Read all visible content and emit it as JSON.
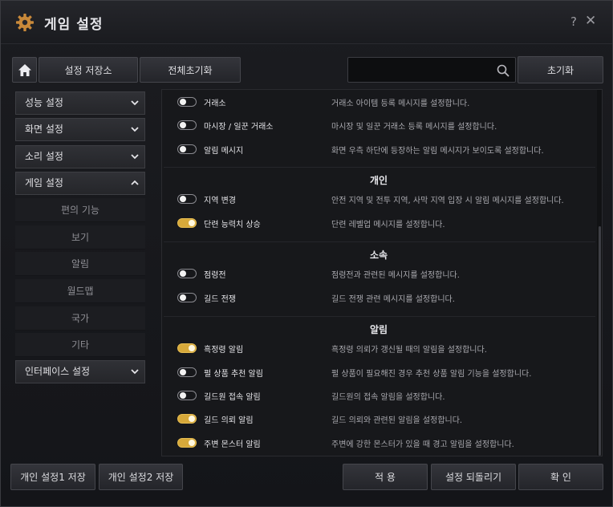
{
  "window": {
    "title": "게임 설정",
    "help": "?",
    "close": "✕"
  },
  "toolbar": {
    "save_store": "설정 저장소",
    "reset_all": "전체초기화",
    "search_value": "",
    "reset": "초기화"
  },
  "sidebar": {
    "categories": [
      {
        "label": "성능 설정",
        "state": "collapsed"
      },
      {
        "label": "화면 설정",
        "state": "collapsed"
      },
      {
        "label": "소리 설정",
        "state": "collapsed"
      },
      {
        "label": "게임 설정",
        "state": "expanded"
      },
      {
        "label": "인터페이스 설정",
        "state": "collapsed"
      }
    ],
    "subitems": [
      "편의 기능",
      "보기",
      "알림",
      "월드맵",
      "국가",
      "기타"
    ]
  },
  "content": {
    "top_rows": [
      {
        "label": "거래소",
        "desc": "거래소 아이템 등록 메시지를 설정합니다.",
        "on": false
      },
      {
        "label": "마시장 / 일꾼 거래소",
        "desc": "마시장 및 일꾼 거래소 등록 메시지를 설정합니다.",
        "on": false
      },
      {
        "label": "알림 메시지",
        "desc": "화면 우측 하단에 등장하는 알림 메시지가 보이도록 설정합니다.",
        "on": false
      }
    ],
    "section_personal": "개인",
    "personal_rows": [
      {
        "label": "지역 변경",
        "desc": "안전 지역 및 전투 지역, 사막 지역 입장 시 알림 메시지를 설정합니다.",
        "on": false
      },
      {
        "label": "단련 능력치 상승",
        "desc": "단련 레벨업 메시지를 설정합니다.",
        "on": true
      }
    ],
    "section_guild": "소속",
    "guild_rows": [
      {
        "label": "점령전",
        "desc": "점령전과 관련된 메시지를 설정합니다.",
        "on": false
      },
      {
        "label": "길드 전쟁",
        "desc": "길드 전쟁 관련 메시지를 설정합니다.",
        "on": false
      }
    ],
    "section_alert": "알림",
    "alert_rows": [
      {
        "label": "흑정령 알림",
        "desc": "흑정령 의뢰가 갱신될 때의 알림을 설정합니다.",
        "on": true
      },
      {
        "label": "펄 상품 추천 알림",
        "desc": "펄 상품이 필요해진 경우 추천 상품 알림 기능을 설정합니다.",
        "on": false
      },
      {
        "label": "길드원 접속 알림",
        "desc": "길드원의 접속 알림을 설정합니다.",
        "on": false
      },
      {
        "label": "길드 의뢰 알림",
        "desc": "길드 의뢰와 관련된 알림을 설정합니다.",
        "on": true
      },
      {
        "label": "주변 몬스터 알림",
        "desc": "주변에 강한 몬스터가 있을 때 경고 알림을 설정합니다.",
        "on": true
      }
    ]
  },
  "footer": {
    "save1": "개인 설정1 저장",
    "save2": "개인 설정2 저장",
    "apply": "적 용",
    "revert": "설정 되돌리기",
    "confirm": "확 인"
  },
  "colors": {
    "toggle_on": "#d7a93a",
    "background": "#17181b"
  },
  "icons": {
    "title": "gear-icon",
    "home": "home-icon",
    "search": "search-icon",
    "expand": "chevron-down-icon",
    "collapse": "chevron-up-icon"
  }
}
